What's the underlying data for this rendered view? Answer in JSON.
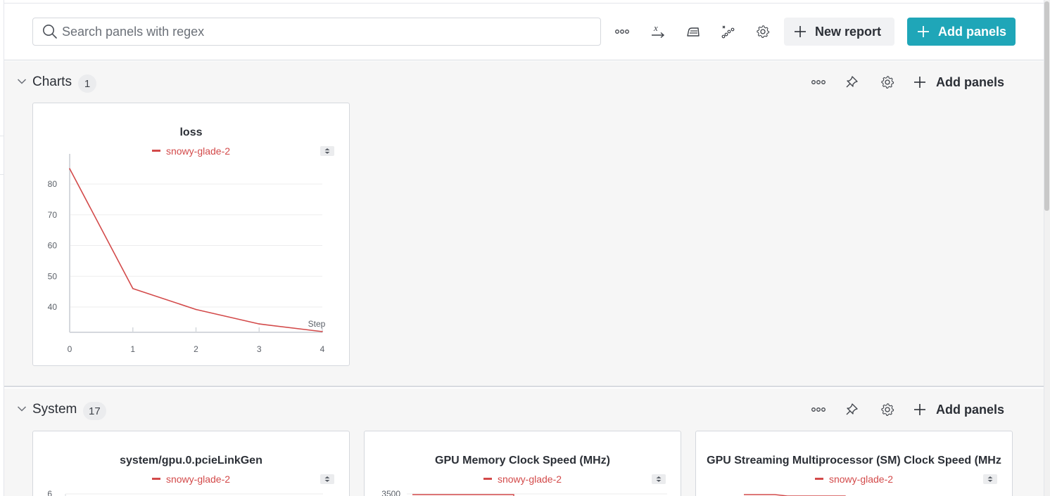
{
  "search": {
    "placeholder": "Search panels with regex"
  },
  "toolbar": {
    "icons": [
      "more-icon",
      "x-axis-icon",
      "smoothing-icon",
      "outliers-icon",
      "gear-icon"
    ],
    "new_report_label": "New report",
    "add_panels_label": "Add panels"
  },
  "colors": {
    "accent": "#1fa6b8",
    "series": "#d34a4a"
  },
  "sections": {
    "charts": {
      "title": "Charts",
      "count": "1",
      "add_panels_label": "Add panels"
    },
    "system": {
      "title": "System",
      "count": "17",
      "add_panels_label": "Add panels"
    }
  },
  "panels": {
    "loss": {
      "title": "loss",
      "legend": "snowy-glade-2"
    },
    "pcie": {
      "title": "system/gpu.0.pcieLinkGen",
      "legend": "snowy-glade-2",
      "y_top_label": "6"
    },
    "memclock": {
      "title": "GPU Memory Clock Speed (MHz)",
      "legend": "snowy-glade-2",
      "y_top_label": "3500"
    },
    "smclock": {
      "title": "GPU Streaming Multiprocessor (SM) Clock Speed (MHz",
      "legend": "snowy-glade-2"
    }
  },
  "chart_data": {
    "type": "line",
    "title": "loss",
    "xlabel": "Step",
    "ylabel": "",
    "x": [
      0,
      1,
      2,
      3,
      4
    ],
    "series": [
      {
        "name": "snowy-glade-2",
        "values": [
          85,
          46,
          39.2,
          34.5,
          32
        ]
      }
    ],
    "xticks": [
      0,
      1,
      2,
      3,
      4
    ],
    "yticks": [
      40,
      50,
      60,
      70,
      80
    ],
    "xlim": [
      0,
      4
    ],
    "ylim": [
      32,
      88
    ],
    "grid": "horizontal",
    "legend_position": "top-center"
  }
}
